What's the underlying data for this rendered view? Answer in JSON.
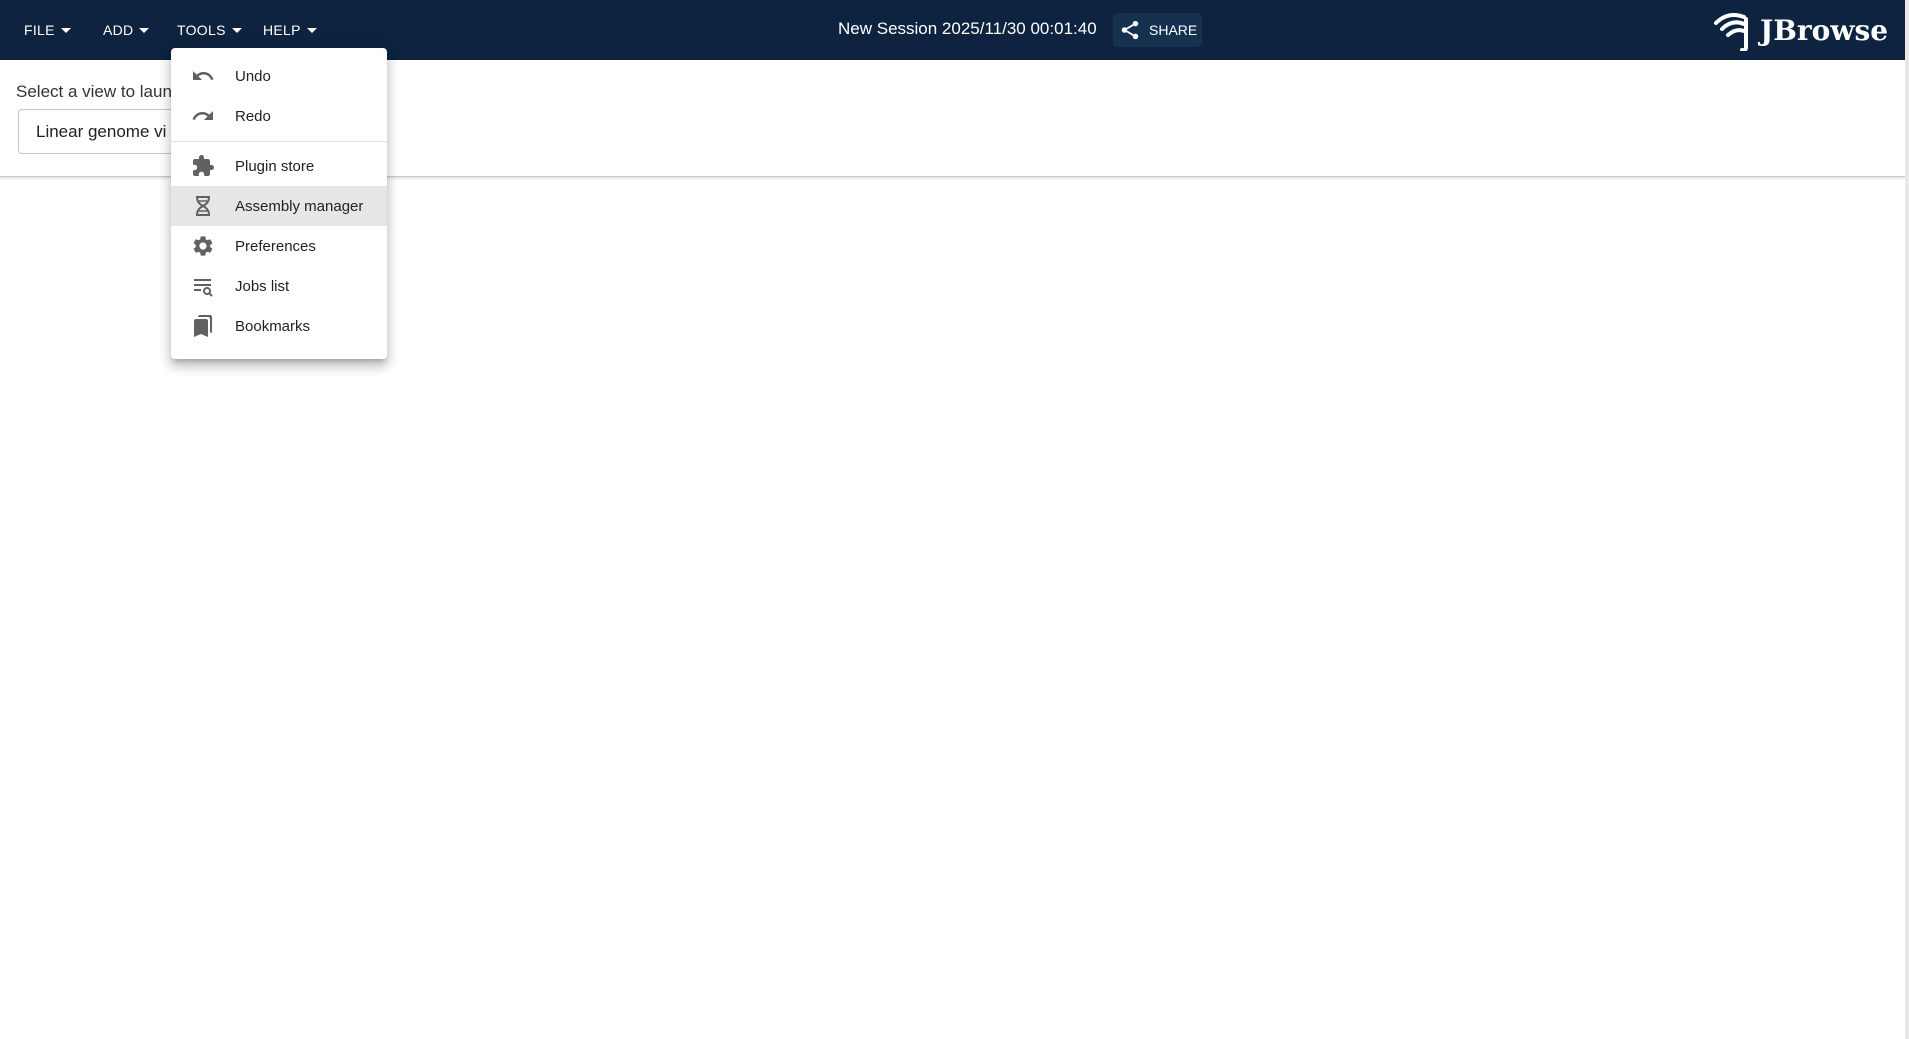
{
  "appbar": {
    "menus": [
      {
        "label": "FILE"
      },
      {
        "label": "ADD"
      },
      {
        "label": "TOOLS"
      },
      {
        "label": "HELP"
      }
    ],
    "session_title": "New Session 2025/11/30 00:01:40",
    "share_label": "SHARE",
    "logo_text": "JBrowse"
  },
  "launcher": {
    "label": "Select a view to laun",
    "selected_view": "Linear genome vi"
  },
  "tools_menu": {
    "items": [
      {
        "label": "Undo",
        "icon": "undo-icon"
      },
      {
        "label": "Redo",
        "icon": "redo-icon"
      },
      {
        "label": "Plugin store",
        "icon": "extension-icon"
      },
      {
        "label": "Assembly manager",
        "icon": "dna-icon",
        "highlighted": true
      },
      {
        "label": "Preferences",
        "icon": "gear-icon"
      },
      {
        "label": "Jobs list",
        "icon": "list-search-icon"
      },
      {
        "label": "Bookmarks",
        "icon": "bookmarks-icon"
      }
    ]
  },
  "colors": {
    "appbar_bg": "#0d233f",
    "menu_icon": "#616161",
    "highlight_bg": "#e6e6e6"
  }
}
